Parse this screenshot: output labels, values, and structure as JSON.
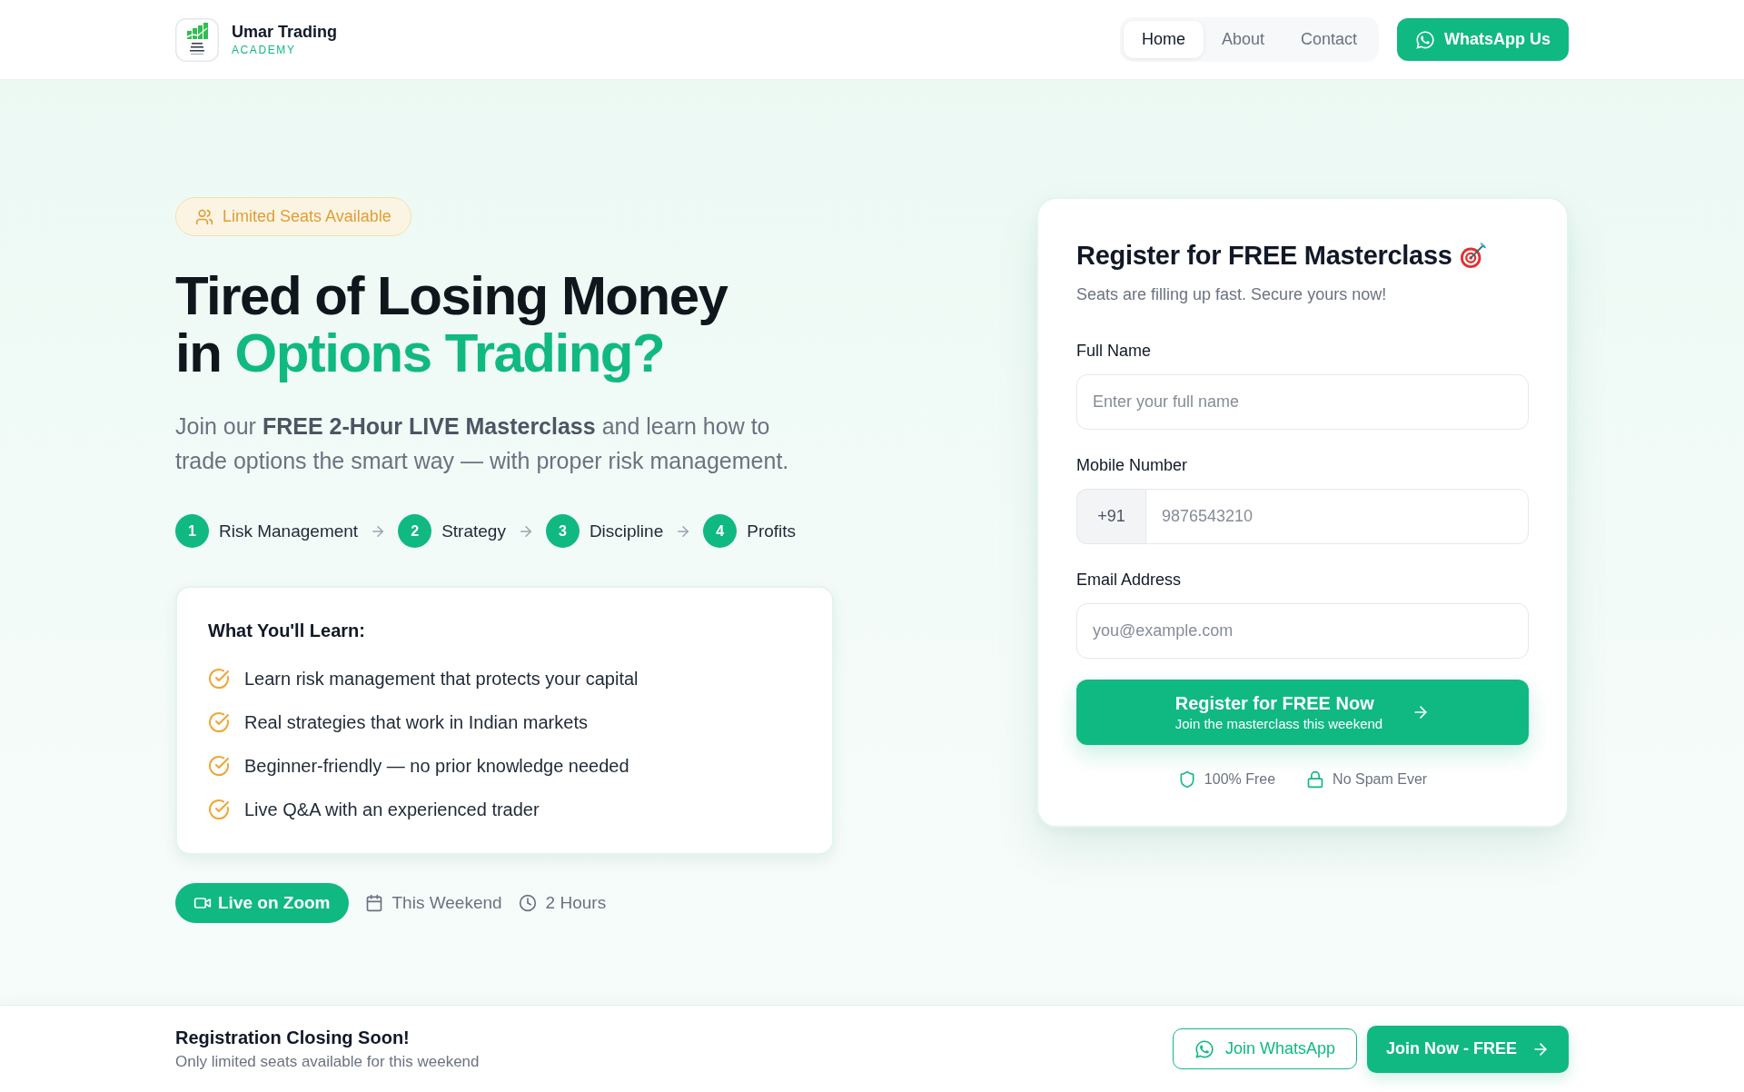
{
  "header": {
    "brand": {
      "name": "Umar Trading",
      "tagline": "ACADEMY"
    },
    "nav": [
      {
        "label": "Home",
        "selected": true
      },
      {
        "label": "About",
        "selected": false
      },
      {
        "label": "Contact",
        "selected": false
      }
    ],
    "cta": {
      "label": "WhatsApp Us"
    }
  },
  "hero": {
    "badge": "Limited Seats Available",
    "headline": {
      "line_1": "Tired of Losing Money",
      "line_2_prefix": "in",
      "line_2_highlight": "Options Trading?"
    },
    "intro": "Join our **FREE 2-Hour LIVE Masterclass** and learn how to trade options the smart way — with proper risk management.",
    "steps": [
      {
        "number": "1",
        "label": "Risk Management"
      },
      {
        "number": "2",
        "label": "Strategy"
      },
      {
        "number": "3",
        "label": "Discipline"
      },
      {
        "number": "4",
        "label": "Profits"
      }
    ],
    "learn_card": {
      "title": "What You'll Learn:",
      "items": [
        "Learn risk management that protects your capital",
        "Real strategies that work in Indian markets",
        "Beginner-friendly — no prior knowledge needed",
        "Live Q&A with an experienced trader"
      ]
    },
    "meta": {
      "platform": "Live on Zoom",
      "when": "This Weekend",
      "duration": "2 Hours"
    }
  },
  "form": {
    "title": "Register for FREE Masterclass",
    "subtitle": "Seats are filling up fast. Secure yours now!",
    "fields": [
      {
        "kind": "text",
        "label": "Full Name",
        "placeholder": "Enter your full name"
      },
      {
        "kind": "phone",
        "label": "Mobile Number",
        "prefix": "+91",
        "placeholder": "9876543210"
      },
      {
        "kind": "email",
        "label": "Email Address",
        "placeholder": "you@example.com"
      }
    ],
    "submit": {
      "label": "Register for FREE Now",
      "sublabel": "Join the masterclass this weekend"
    },
    "assurances": [
      {
        "kind": "shield",
        "label": "100% Free"
      },
      {
        "kind": "lock",
        "label": "No Spam Ever"
      }
    ]
  },
  "sticky_bar": {
    "title": "Registration Closing Soon!",
    "subtitle": "Only limited seats available for this weekend",
    "buttons": [
      {
        "kind": "outline",
        "label": "Join WhatsApp"
      },
      {
        "kind": "primary",
        "label": "Join Now - FREE"
      }
    ]
  }
}
